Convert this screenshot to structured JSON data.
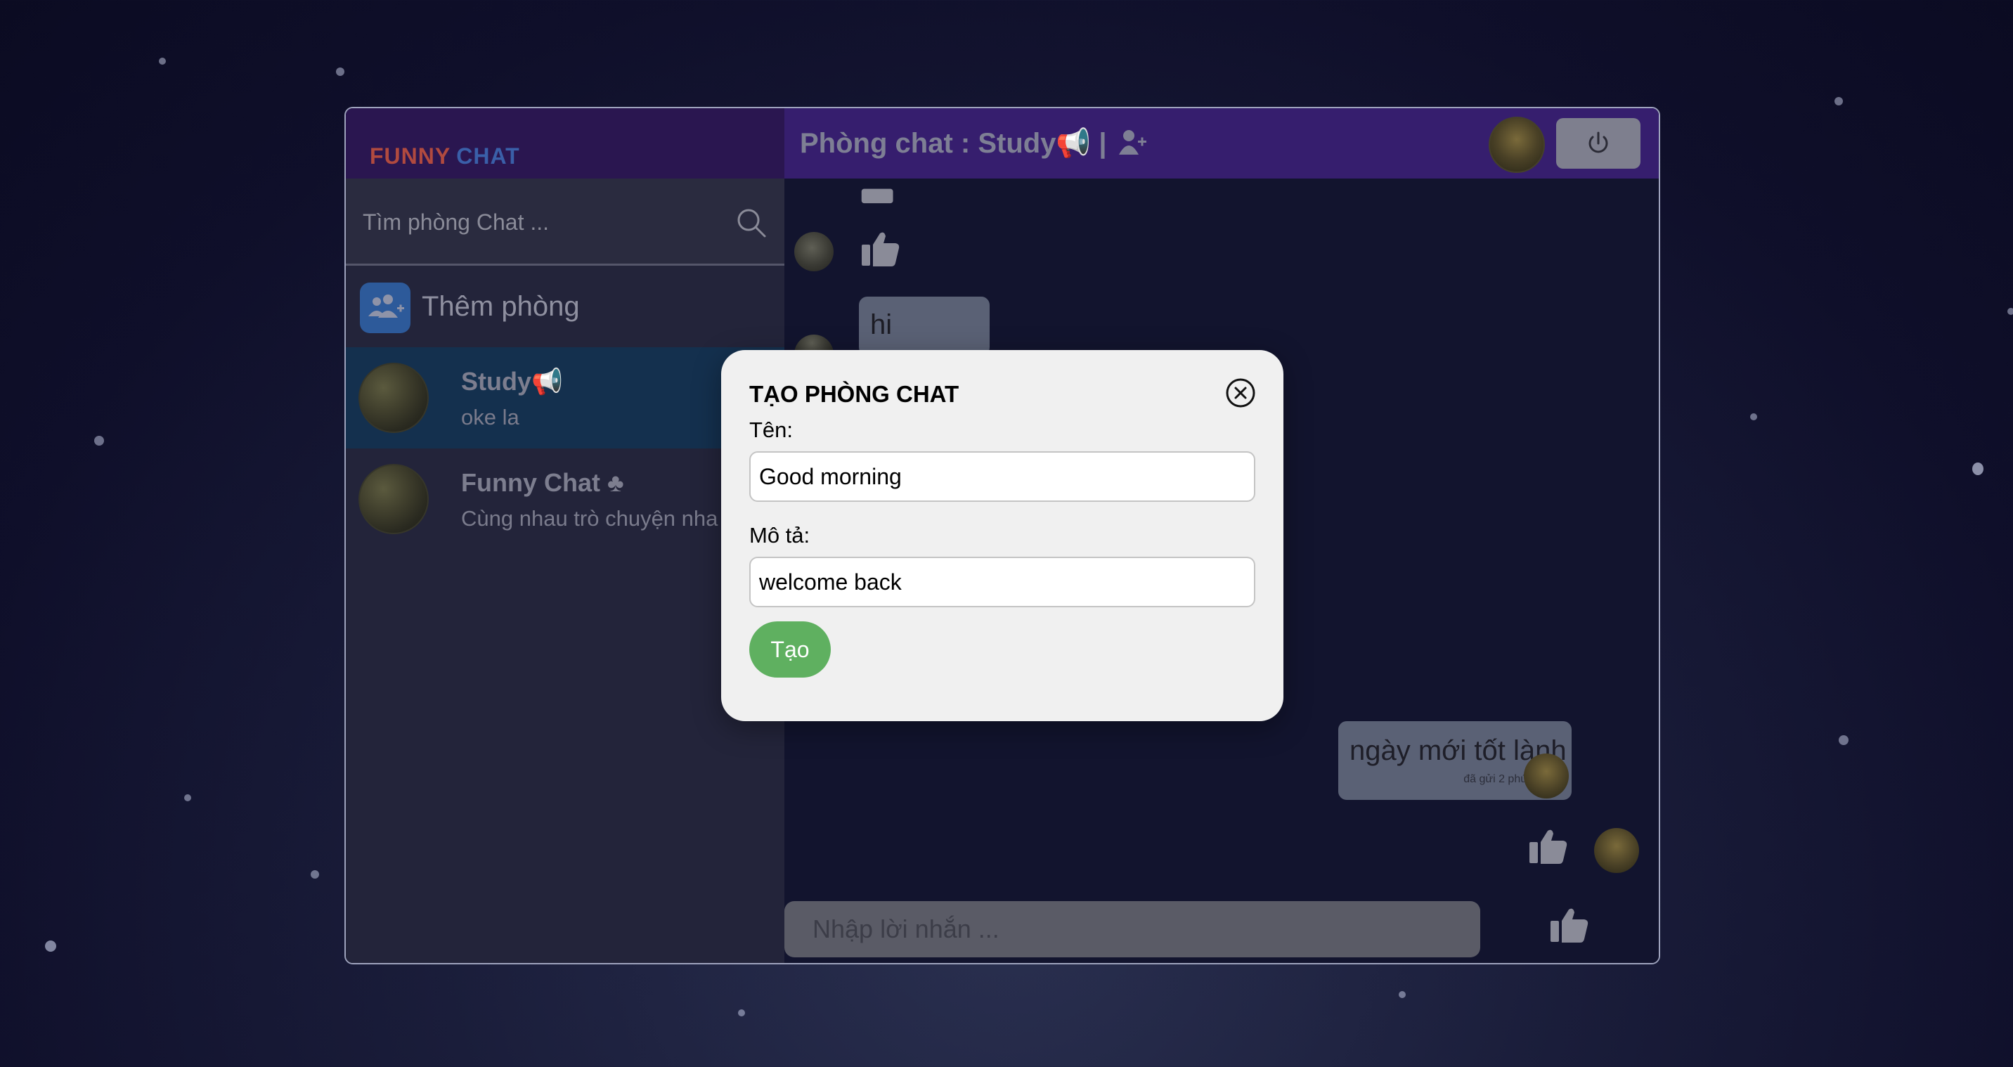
{
  "brand": {
    "part1": "FUNNY",
    "part2": "CHAT"
  },
  "sidebar": {
    "search_placeholder": "Tìm phòng Chat ...",
    "add_room_label": "Thêm phòng",
    "rooms": [
      {
        "name": "Study📢",
        "last_message": "oke la",
        "active": true
      },
      {
        "name": "Funny Chat ♣",
        "last_message": "Cùng nhau trò chuyện nha",
        "active": false
      }
    ]
  },
  "chat": {
    "header_title": "Phòng chat :  Study📢  |",
    "messages": [
      {
        "text": "hi",
        "side": "left"
      },
      {
        "text": "ngày mới tốt lành",
        "time": "đã gửi 2 phút trước",
        "side": "right"
      }
    ],
    "composer_placeholder": "Nhập lời nhắn ..."
  },
  "modal": {
    "title": "TẠO PHÒNG CHAT",
    "name_label": "Tên:",
    "name_value": "Good morning",
    "desc_label": "Mô tả:",
    "desc_value": "welcome back",
    "create_label": "Tạo"
  },
  "colors": {
    "header": "#361e6e",
    "active_room": "#14304e",
    "create_button": "#5fb060",
    "brand_funny": "#b04a3f",
    "brand_chat": "#3a5fa8"
  },
  "icons": [
    "search-icon",
    "add-group-icon",
    "add-member-icon",
    "power-icon",
    "thumbs-up-icon",
    "close-icon"
  ]
}
